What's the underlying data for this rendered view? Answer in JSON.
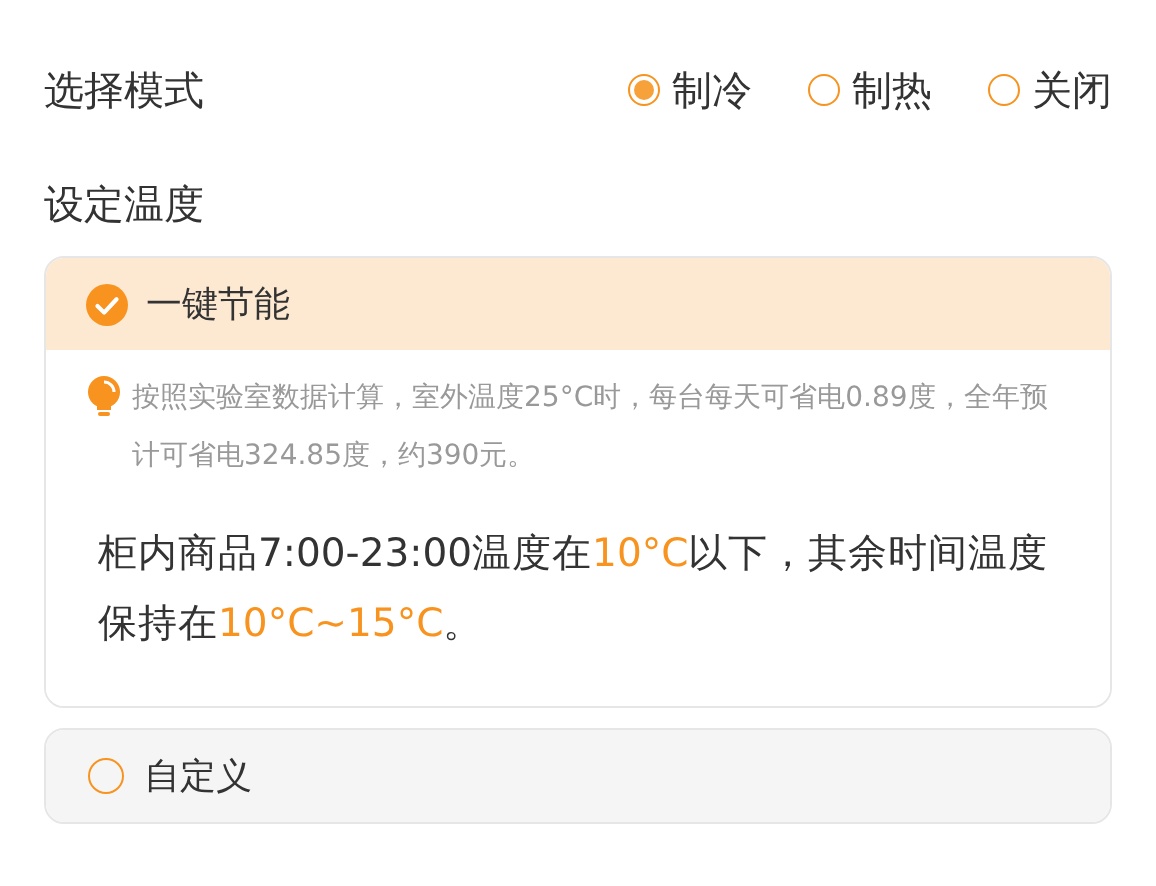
{
  "mode": {
    "label": "选择模式",
    "options": [
      {
        "label": "制冷",
        "selected": true
      },
      {
        "label": "制热",
        "selected": false
      },
      {
        "label": "关闭",
        "selected": false
      }
    ]
  },
  "temperature": {
    "label": "设定温度",
    "plans": [
      {
        "label": "一键节能",
        "selected": true,
        "tip": "按照实验室数据计算，室外温度25°C时，每台每天可省电0.89度，全年预计可省电324.85度，约390元。",
        "description": [
          {
            "text": "柜内商品7:00-23:00温度在",
            "highlight": false
          },
          {
            "text": "10°C",
            "highlight": true
          },
          {
            "text": "以下，其余时间温度保持在",
            "highlight": false
          },
          {
            "text": "10°C~15°C",
            "highlight": true
          },
          {
            "text": "。",
            "highlight": false
          }
        ]
      },
      {
        "label": "自定义",
        "selected": false
      }
    ]
  }
}
